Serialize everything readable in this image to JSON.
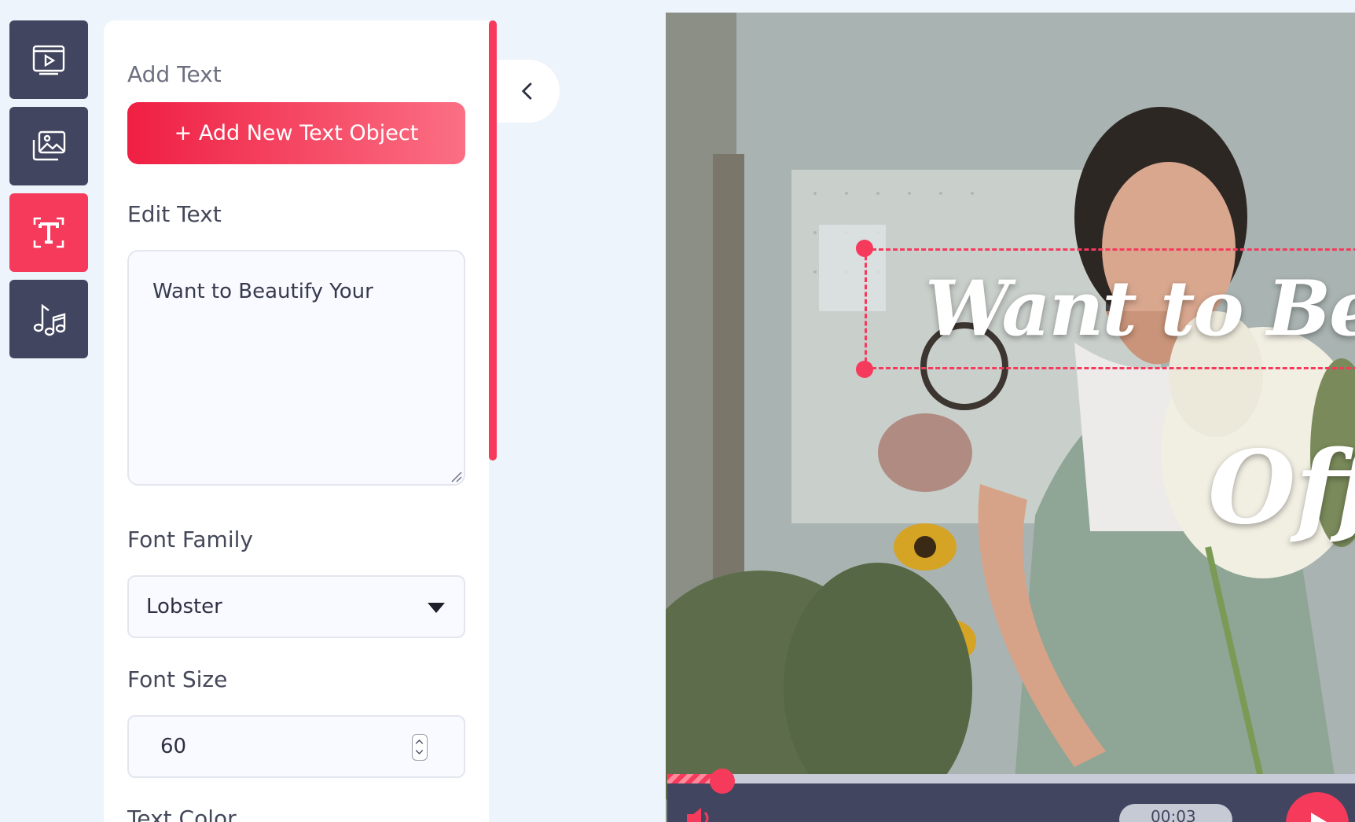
{
  "sidebar": {
    "items": [
      {
        "icon": "video-icon",
        "active": false
      },
      {
        "icon": "images-icon",
        "active": false
      },
      {
        "icon": "text-icon",
        "active": true
      },
      {
        "icon": "music-icon",
        "active": false
      }
    ]
  },
  "panel": {
    "add_text_label": "Add Text",
    "add_button_label": "+ Add New Text Object",
    "edit_text_label": "Edit Text",
    "edit_text_value": "Want to Beautify Your",
    "font_family_label": "Font Family",
    "font_family_value": "Lobster",
    "font_size_label": "Font Size",
    "font_size_value": "60",
    "text_color_label": "Text Color"
  },
  "preview": {
    "overlay_line1": "Want to Bea",
    "overlay_line2": "Off"
  },
  "player": {
    "time": "00:03",
    "progress_fraction": 0.08
  },
  "colors": {
    "accent": "#f53a5c",
    "rail": "#42455f",
    "background": "#eef4fb"
  }
}
